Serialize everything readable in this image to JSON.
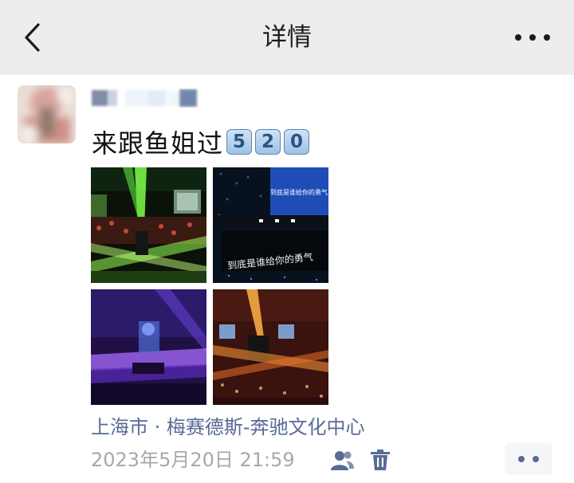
{
  "header": {
    "title": "详情",
    "back_icon": "chevron-left-icon",
    "more_icon": "more-dots-icon"
  },
  "post": {
    "text": "来跟鱼姐过",
    "keycaps": [
      "5",
      "2",
      "0"
    ],
    "photos": [
      {
        "name": "concert-photo-green-lasers"
      },
      {
        "name": "concert-photo-screen-text",
        "screen_text_top": "到底是谁给你的勇气",
        "screen_text_bottom": "到底是谁给你的勇气"
      },
      {
        "name": "concert-photo-purple-stage"
      },
      {
        "name": "concert-photo-orange-spotlight"
      }
    ],
    "location": "上海市 · 梅赛德斯-奔驰文化中心",
    "timestamp": "2023年5月20日 21:59"
  },
  "colors": {
    "header_bg": "#ededed",
    "link_blue": "#576b95",
    "meta_gray": "#a8a8a8"
  }
}
